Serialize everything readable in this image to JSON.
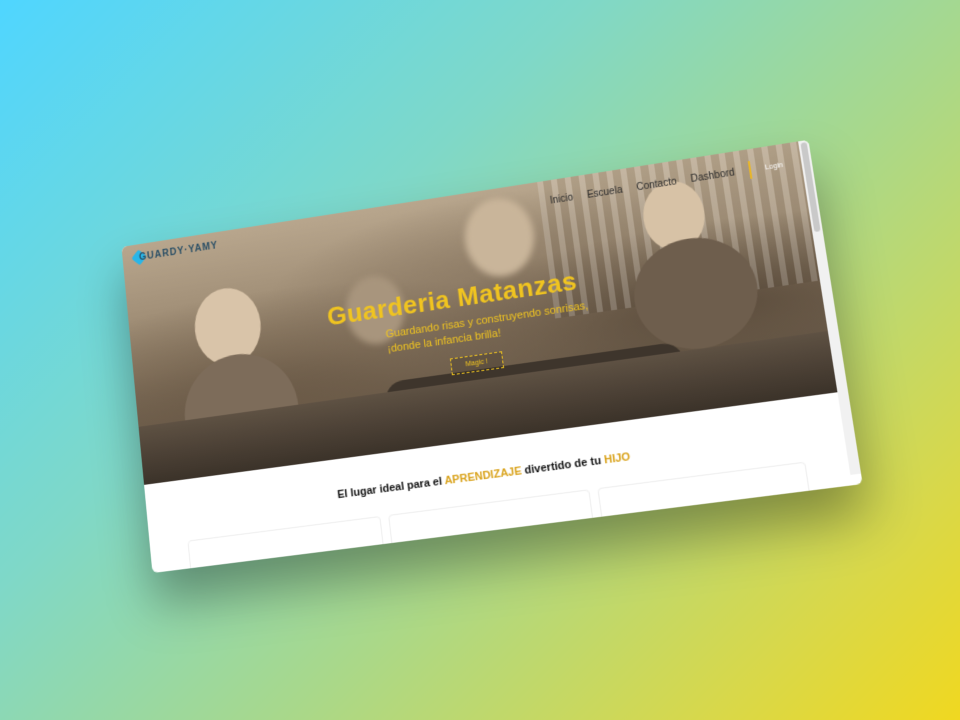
{
  "brand": {
    "logo_text": "GUARDY·YAMY"
  },
  "nav": {
    "items": [
      "Inicio",
      "Escuela",
      "Contacto",
      "Dashbord"
    ],
    "login_label": "Login"
  },
  "hero": {
    "title": "Guarderia Matanzas",
    "tagline": "Guardando risas y construyendo sonrisas, ¡donde la infancia brilla!",
    "button_label": "Magic !"
  },
  "section": {
    "prefix": "El lugar ideal para el",
    "highlight1": "APRENDIZAJE",
    "middle": "divertido de tu",
    "highlight2": "HIJO"
  },
  "colors": {
    "accent": "#f0c420",
    "logo_blue": "#29b6e8"
  }
}
